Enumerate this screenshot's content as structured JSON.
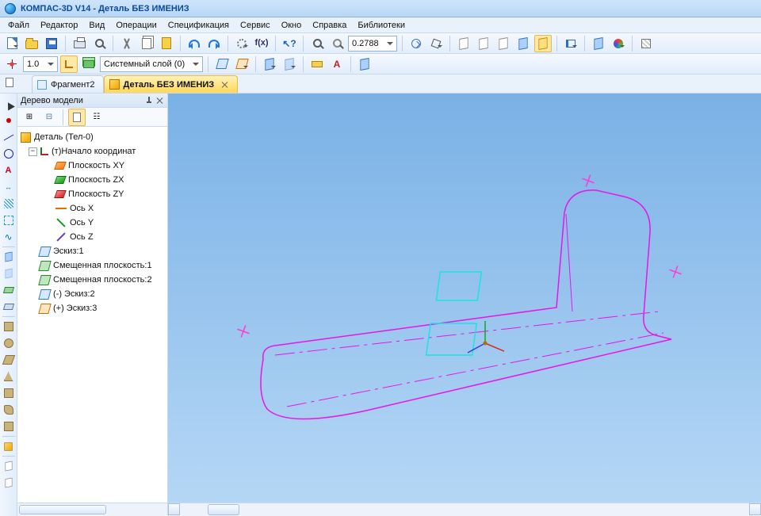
{
  "title": "КОМПАС-3D V14 - Деталь БЕЗ ИМЕНИЗ",
  "menu": [
    "Файл",
    "Редактор",
    "Вид",
    "Операции",
    "Спецификация",
    "Сервис",
    "Окно",
    "Справка",
    "Библиотеки"
  ],
  "toolbar1": {
    "zoom_value": "0.2788"
  },
  "toolbar2": {
    "step_value": "1.0",
    "layer_combo": "Системный слой (0)"
  },
  "tabs": [
    {
      "label": "Фрагмент2",
      "active": false
    },
    {
      "label": "Деталь БЕЗ ИМЕНИЗ",
      "active": true
    }
  ],
  "panel": {
    "title": "Дерево модели"
  },
  "tree": {
    "root": "Деталь (Тел-0)",
    "origin": "(т)Начало координат",
    "planes": [
      "Плоскость XY",
      "Плоскость ZX",
      "Плоскость ZY"
    ],
    "axes": [
      "Ось X",
      "Ось Y",
      "Ось Z"
    ],
    "items": [
      "Эскиз:1",
      "Смещенная плоскость:1",
      "Смещенная плоскость:2",
      "(-) Эскиз:2",
      "(+) Эскиз:3"
    ]
  }
}
